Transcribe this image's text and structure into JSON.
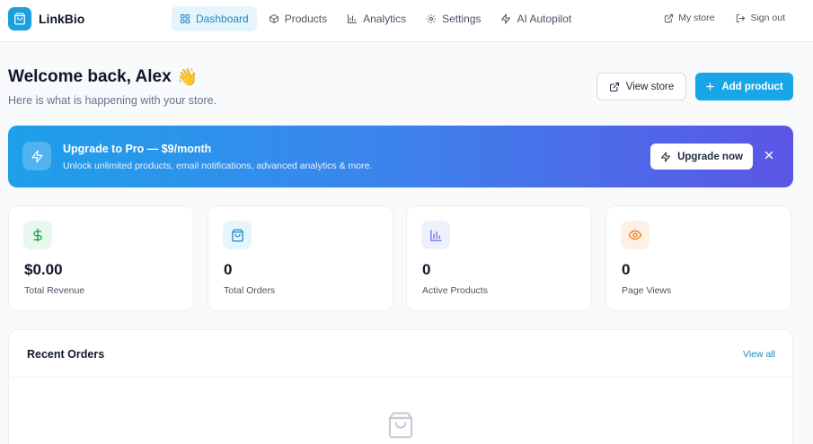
{
  "brand": {
    "name": "LinkBio",
    "color": "#1a9fe0",
    "icon": "shopping-bag-icon"
  },
  "nav": {
    "items": [
      {
        "label": "Dashboard",
        "icon": "grid-icon",
        "active": true
      },
      {
        "label": "Products",
        "icon": "box-icon"
      },
      {
        "label": "Analytics",
        "icon": "bar-chart-icon"
      },
      {
        "label": "Settings",
        "icon": "gear-icon"
      },
      {
        "label": "AI Autopilot",
        "icon": "lightning-icon"
      }
    ],
    "right": [
      {
        "label": "My store",
        "icon": "external-link-icon"
      },
      {
        "label": "Sign out",
        "icon": "sign-out-icon"
      }
    ]
  },
  "header": {
    "welcome": "Welcome back, Alex",
    "emoji": "👋",
    "subtitle": "Here is what is happening with your store.",
    "view_store_label": "View store",
    "add_product_label": "Add product"
  },
  "banner": {
    "title": "Upgrade to Pro — $9/month",
    "description": "Unlock unlimited products, email notifications, advanced analytics & more.",
    "button_label": "Upgrade now"
  },
  "stats": [
    {
      "value": "$0.00",
      "label": "Total Revenue",
      "icon": "dollar-icon",
      "color": "#16a34a",
      "bg": "#e8f8ee"
    },
    {
      "value": "0",
      "label": "Total Orders",
      "icon": "shopping-bag-icon",
      "color": "#1c8ac4",
      "bg": "#e6f4fb"
    },
    {
      "value": "0",
      "label": "Active Products",
      "icon": "bar-chart-icon",
      "color": "#6366f1",
      "bg": "#eef0fd"
    },
    {
      "value": "0",
      "label": "Page Views",
      "icon": "eye-icon",
      "color": "#ea7a1a",
      "bg": "#fdf1e6"
    }
  ],
  "orders": {
    "title": "Recent Orders",
    "view_all_label": "View all",
    "empty_icon": "shopping-bag-icon"
  }
}
